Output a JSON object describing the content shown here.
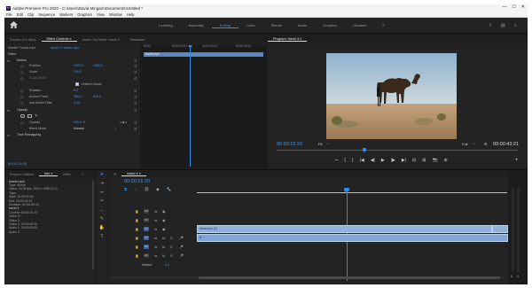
{
  "window": {
    "title": "Adobe Premiere Pro 2020 - C:\\Users\\David Mingam\\Documents\\Untitled *",
    "app_badge": "Pr",
    "controls": [
      "—",
      "☐",
      "✕"
    ]
  },
  "menu": [
    "File",
    "Edit",
    "Clip",
    "Sequence",
    "Markers",
    "Graphics",
    "View",
    "Window",
    "Help"
  ],
  "workspaces": [
    "Learning",
    "Assembly",
    "Editing",
    "Color",
    "Effects",
    "Audio",
    "Graphics",
    "Libraries"
  ],
  "workspace_active_index": 2,
  "effect_controls": {
    "tabs": [
      "Source: (no clips)",
      "Effect Controls ≡",
      "Audio Clip Mixer: travel 4",
      "Metadata"
    ],
    "source_path": "Master * travel.mp4",
    "sequence_path": "travel 4 * travel.mp4",
    "ruler": [
      "00:00",
      "00:00:15:00",
      "00:00:20:00",
      "00:00:25:00"
    ],
    "clip_label": "travel.mp4",
    "sections": {
      "video": "Video",
      "motion": "Motion",
      "opacity": "Opacity",
      "time_remap": "Time Remapping"
    },
    "params": [
      {
        "label": "Position",
        "v1": "1920.0",
        "v2": "1080.0"
      },
      {
        "label": "Scale",
        "v1": "100.0",
        "v2": ""
      },
      {
        "label": "Scale Width",
        "v1": "",
        "v2": ""
      },
      {
        "label": "Uniform Scale",
        "v1": "",
        "v2": ""
      },
      {
        "label": "Rotation",
        "v1": "0.0",
        "v2": ""
      },
      {
        "label": "Anchor Point",
        "v1": "960.0",
        "v2": "540.0"
      },
      {
        "label": "Anti-flicker Filter",
        "v1": "0.00",
        "v2": ""
      }
    ],
    "opacity": {
      "label": "Opacity",
      "value": "100.0 %"
    },
    "blend": {
      "label": "Blend Mode",
      "value": "Normal"
    },
    "timecode": "00:00:15:20"
  },
  "program": {
    "title": "Program: travel 4 ≡",
    "timecode_current": "00:00:15:20",
    "fit": "Fit",
    "full": "Full",
    "timecode_total": "00:00:43:21",
    "transport": [
      "⊸",
      "{",
      "}",
      "|◀",
      "◀|",
      "▶",
      "|▶",
      "▶|",
      "⊟",
      "⊞",
      "📷",
      "⊕",
      "+"
    ]
  },
  "project": {
    "tabs": [
      "Project: Untitled",
      "Info ≡",
      "Effec",
      "»"
    ],
    "clip_name": "travel.mp4",
    "lines": [
      "Type: Movie",
      "Video: 24.00 fps, 1920 x 1080 (1.0)",
      "",
      "Tape:",
      "Start: 00:00:00:00",
      "End: 00:00:43:21",
      "Duration: 00:00:43:22",
      "",
      "",
      "",
      "travel 4",
      "",
      "Current: 00:00:15:20",
      "",
      "Video 3:",
      "Video 2:",
      "Video 1: 00:00:00:00",
      "",
      "Audio 1: 00:00:00:00",
      "Audio 2:"
    ]
  },
  "timeline": {
    "tab": "travel 4 ≡",
    "timecode": "00:00:15:20",
    "tracks": [
      {
        "name": "V3",
        "kind": "video"
      },
      {
        "name": "V2",
        "kind": "video"
      },
      {
        "name": "V1",
        "kind": "video"
      },
      {
        "name": "A1",
        "kind": "audio"
      },
      {
        "name": "A2",
        "kind": "audio"
      },
      {
        "name": "A3",
        "kind": "audio"
      }
    ],
    "master": {
      "label": "Master",
      "value": "0.0"
    },
    "clip_label": "travel.mp4 [V]",
    "audio_meter_labels": [
      "S",
      "S"
    ]
  },
  "colors": {
    "accent": "#2d8ceb",
    "clip_video": "#8fb0d8",
    "clip_audio": "#7fa5d6",
    "bg_panel": "#232323",
    "yellow_line": "#d7d232"
  }
}
